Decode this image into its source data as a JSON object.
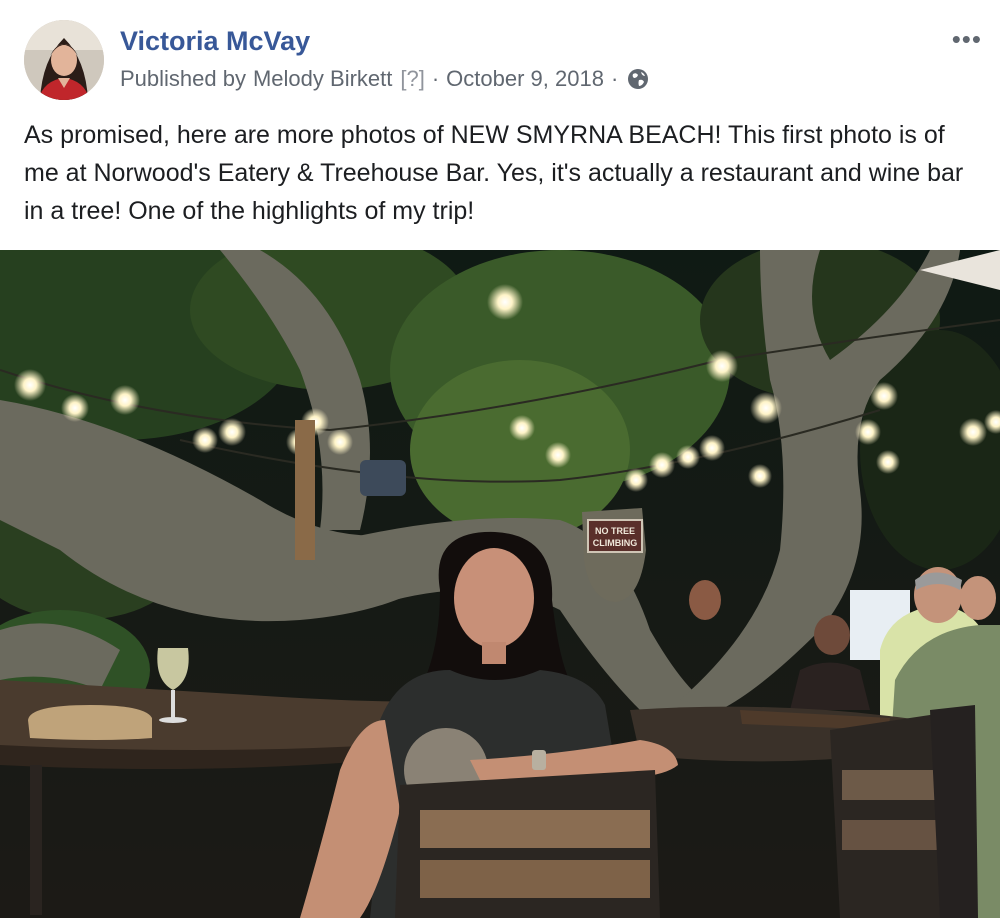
{
  "post": {
    "author": "Victoria McVay",
    "published_by_prefix": "Published by",
    "publisher": "Melody Birkett",
    "publisher_help": "[?]",
    "date": "October 9, 2018",
    "separator": "·",
    "privacy_icon": "globe-icon",
    "more_icon": "more-options-icon",
    "more_label": "•••",
    "text": "As promised, here are more photos of NEW SMYRNA BEACH! This first photo is of me at Norwood's Eatery & Treehouse Bar. Yes, it's actually a restaurant and wine bar in a tree! One of the highlights of my trip!",
    "photo": {
      "sign_line1": "NO TREE",
      "sign_line2": "CLIMBING"
    }
  },
  "colors": {
    "author": "#385898",
    "meta": "#606770",
    "text": "#1c1e21"
  }
}
